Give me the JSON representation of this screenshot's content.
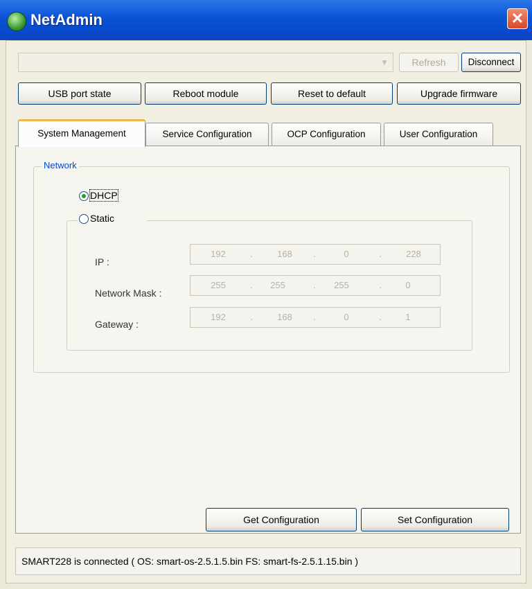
{
  "window": {
    "title": "NetAdmin",
    "icon": "network-globe-icon",
    "close_icon": "close-icon"
  },
  "toolbar": {
    "device_select_value": "",
    "refresh_label": "Refresh",
    "disconnect_label": "Disconnect",
    "buttons": [
      "USB port state",
      "Reboot module",
      "Reset to default",
      "Upgrade firmware"
    ]
  },
  "tabs": [
    "System Management",
    "Service Configuration",
    "OCP Configuration",
    "User Configuration"
  ],
  "active_tab": "System Management",
  "network": {
    "legend": "Network",
    "dhcp_label": "DHCP",
    "static_label": "Static",
    "selected": "DHCP",
    "fields": [
      {
        "label": "IP :",
        "octets": [
          "192",
          "168",
          "0",
          "228"
        ]
      },
      {
        "label": "Network Mask :",
        "octets": [
          "255",
          "255",
          "255",
          "0"
        ]
      },
      {
        "label": "Gateway :",
        "octets": [
          "192",
          "168",
          "0",
          "1"
        ]
      }
    ]
  },
  "actions": {
    "get_label": "Get Configuration",
    "set_label": "Set Configuration"
  },
  "status": {
    "text": "SMART228 is connected ( OS: smart-os-2.5.1.5.bin  FS: smart-fs-2.5.1.15.bin )"
  }
}
